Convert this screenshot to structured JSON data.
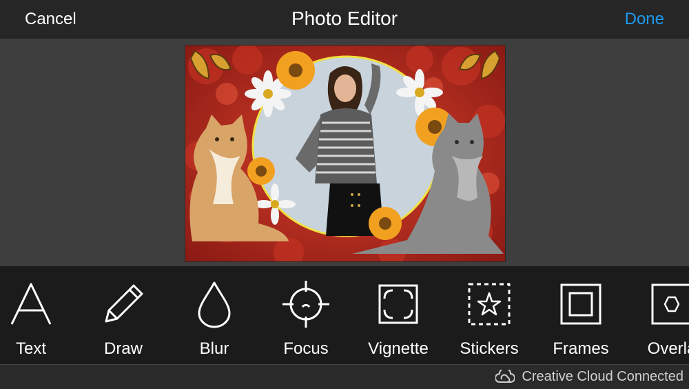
{
  "header": {
    "cancel_label": "Cancel",
    "title": "Photo Editor",
    "done_label": "Done"
  },
  "colors": {
    "accent": "#1c9bf0",
    "toolbar_bg": "#1b1b1b",
    "canvas_bg": "#3e3e3e"
  },
  "tools": [
    {
      "label": "Text",
      "icon": "text-icon"
    },
    {
      "label": "Draw",
      "icon": "pencil-icon"
    },
    {
      "label": "Blur",
      "icon": "drop-icon"
    },
    {
      "label": "Focus",
      "icon": "crosshair-icon"
    },
    {
      "label": "Vignette",
      "icon": "vignette-icon"
    },
    {
      "label": "Stickers",
      "icon": "star-sticker-icon"
    },
    {
      "label": "Frames",
      "icon": "frame-icon"
    },
    {
      "label": "Overla",
      "icon": "hexagon-icon"
    }
  ],
  "status": {
    "cloud_label": "Creative Cloud Connected"
  }
}
